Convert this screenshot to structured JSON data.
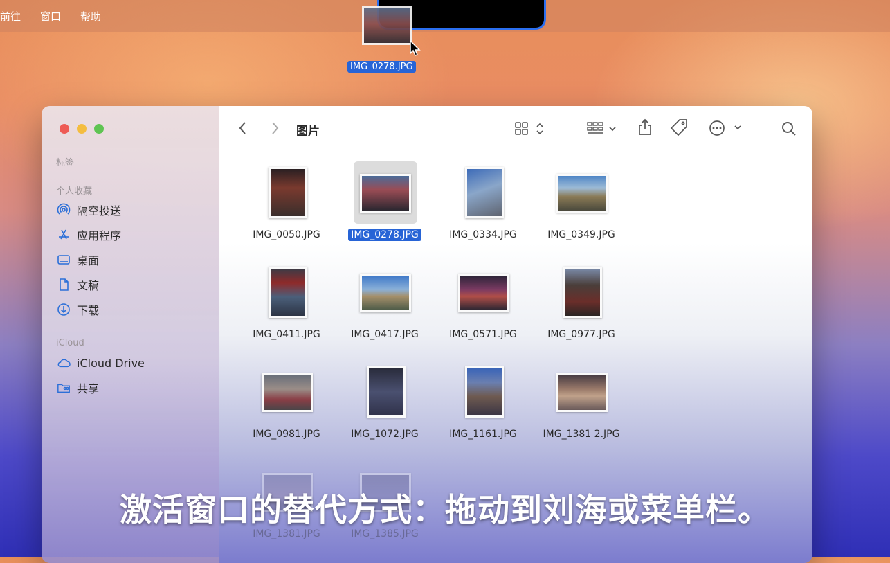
{
  "menubar": {
    "items": [
      "前往",
      "窗口",
      "帮助"
    ]
  },
  "drag": {
    "filename": "IMG_0278.JPG"
  },
  "sidebar": {
    "tags_header": "标签",
    "favorites_header": "个人收藏",
    "favorites": [
      {
        "label": "隔空投送",
        "icon": "airdrop-icon"
      },
      {
        "label": "应用程序",
        "icon": "applications-icon"
      },
      {
        "label": "桌面",
        "icon": "desktop-icon"
      },
      {
        "label": "文稿",
        "icon": "document-icon"
      },
      {
        "label": "下载",
        "icon": "download-icon"
      }
    ],
    "icloud_header": "iCloud",
    "icloud": [
      {
        "label": "iCloud Drive",
        "icon": "cloud-icon"
      },
      {
        "label": "共享",
        "icon": "shared-folder-icon"
      }
    ]
  },
  "toolbar": {
    "title": "图片"
  },
  "files": [
    "IMG_0050.JPG",
    "IMG_0278.JPG",
    "IMG_0334.JPG",
    "IMG_0349.JPG",
    "IMG_0411.JPG",
    "IMG_0417.JPG",
    "IMG_0571.JPG",
    "IMG_0977.JPG",
    "IMG_0981.JPG",
    "IMG_1072.JPG",
    "IMG_1161.JPG",
    "IMG_1381 2.JPG",
    "IMG_1381.JPG",
    "IMG_1385.JPG"
  ],
  "selected_file": "IMG_0278.JPG",
  "subtitle": "激活窗口的替代方式：拖动到刘海或菜单栏。",
  "colors": {
    "accent": "#2764d6",
    "close": "#ee5b55",
    "minimize": "#f4bd3f",
    "zoom": "#5fc452"
  }
}
